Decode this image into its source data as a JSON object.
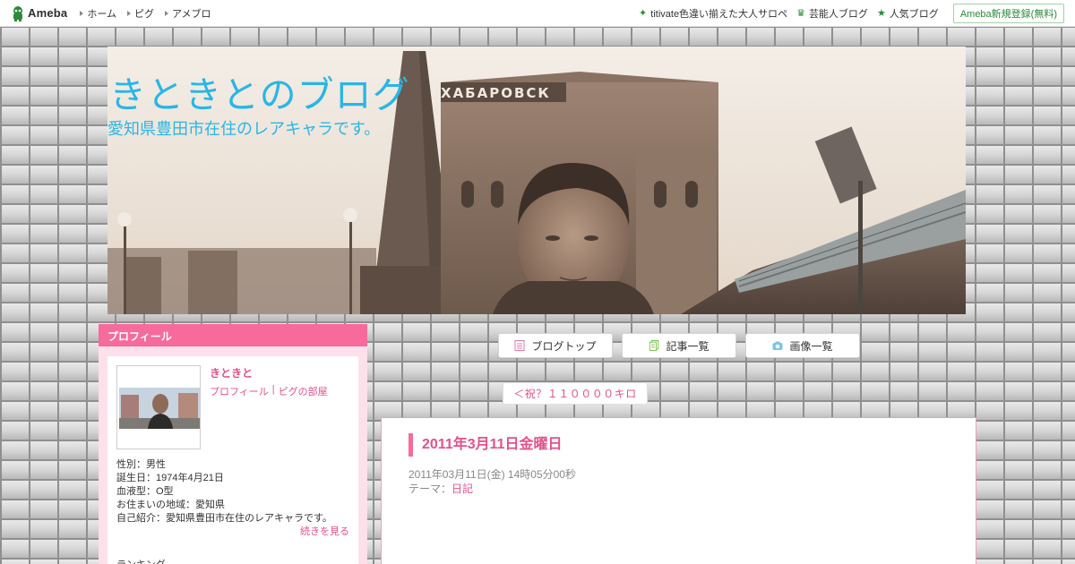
{
  "header": {
    "logo": "Ameba",
    "nav_left": [
      "ホーム",
      "ピグ",
      "アメブロ"
    ],
    "nav_right": [
      {
        "icon": "sparkle-icon",
        "label": "titivate色違い揃えた大人サロペ"
      },
      {
        "icon": "crown-icon",
        "label": "芸能人ブログ"
      },
      {
        "icon": "star-icon",
        "label": "人気ブログ"
      }
    ],
    "signup": "Ameba新規登録(無料)"
  },
  "blog": {
    "title": "きときとのブログ",
    "subtitle": "愛知県豊田市在住のレアキャラです。",
    "banner_sign": "ХАБАРОВСК"
  },
  "sidebar": {
    "heading": "プロフィール",
    "user_name": "きときと",
    "links": [
      "プロフィール",
      "ピグの部屋"
    ],
    "info": [
      "性別：男性",
      "誕生日：1974年4月21日",
      "血液型：O型",
      "お住まいの地域：愛知県",
      "自己紹介：愛知県豊田市在住のレアキャラです。"
    ],
    "read_more": "続きを見る",
    "ranking": "ランキング"
  },
  "tabs": [
    {
      "label": "ブログトップ",
      "icon": "document-icon"
    },
    {
      "label": "記事一覧",
      "icon": "list-icon"
    },
    {
      "label": "画像一覧",
      "icon": "camera-icon"
    }
  ],
  "prev_link": "＜祝？１１００００キロ",
  "article": {
    "title": "2011年3月11日金曜日",
    "date": "2011年03月11日(金) 14時05分00秒",
    "theme_label": "テーマ：",
    "theme": "日記"
  },
  "colors": {
    "accent_pink": "#f66b9c",
    "link_pink": "#e4508a",
    "title_blue": "#29b6e6",
    "ameba_green": "#2d8a3a"
  }
}
